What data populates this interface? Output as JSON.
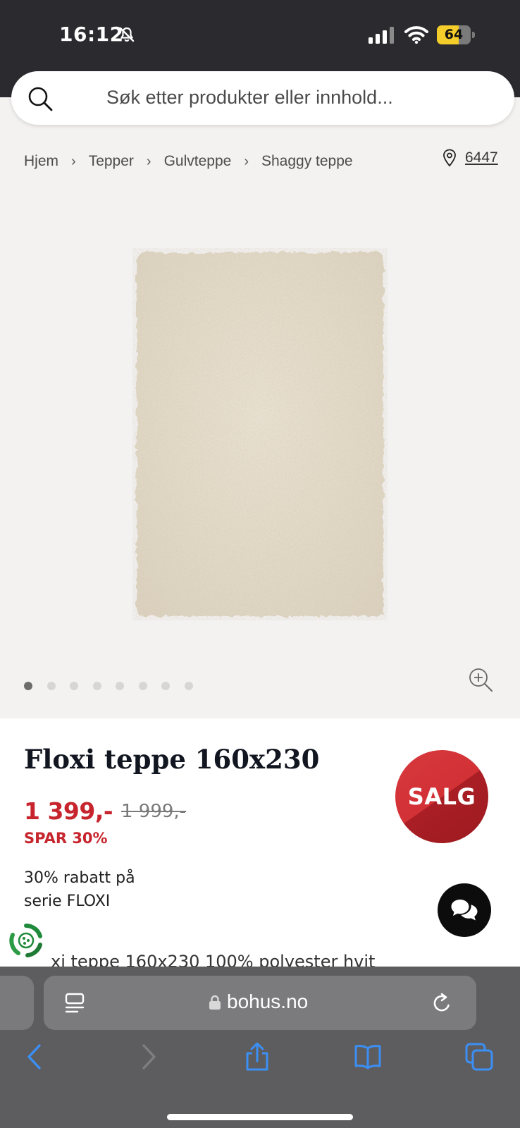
{
  "status_bar": {
    "time": "16:12",
    "battery": "64",
    "battery_level": 0.64,
    "icons": [
      "bell-slash-icon",
      "signal-icon",
      "wifi-icon",
      "battery-icon"
    ]
  },
  "search": {
    "placeholder": "Søk etter produkter eller innhold...",
    "icon": "search-icon"
  },
  "breadcrumb": {
    "items": [
      "Hjem",
      "Tepper",
      "Gulvteppe",
      "Shaggy teppe"
    ],
    "separator": "›"
  },
  "store": {
    "icon": "map-pin-icon",
    "number": "6447"
  },
  "gallery": {
    "image": "shaggy-rug-image",
    "image_count": 8,
    "active_index": 0,
    "zoom_icon": "zoom-in-icon"
  },
  "product": {
    "title": "Floxi teppe 160x230",
    "price": "1 399,-",
    "old_price": "1 999,-",
    "savings": "SPAR 30%",
    "discount_line1": "30% rabatt på",
    "discount_line2": "serie FLOXI",
    "sale_badge": "SALG",
    "description_partial": "xi teppe 160x230 100% polyester hvit"
  },
  "colors": {
    "price_red": "#c7252e",
    "badge_red": "#d23136",
    "status_bar": "#2b2b2f",
    "safari_bar": "#5d5d5f"
  },
  "browser": {
    "url": "bohus.no",
    "icons": [
      "reader-icon",
      "lock-icon",
      "reload-icon",
      "back-icon",
      "forward-icon",
      "share-icon",
      "bookmarks-icon",
      "tabs-icon"
    ]
  }
}
